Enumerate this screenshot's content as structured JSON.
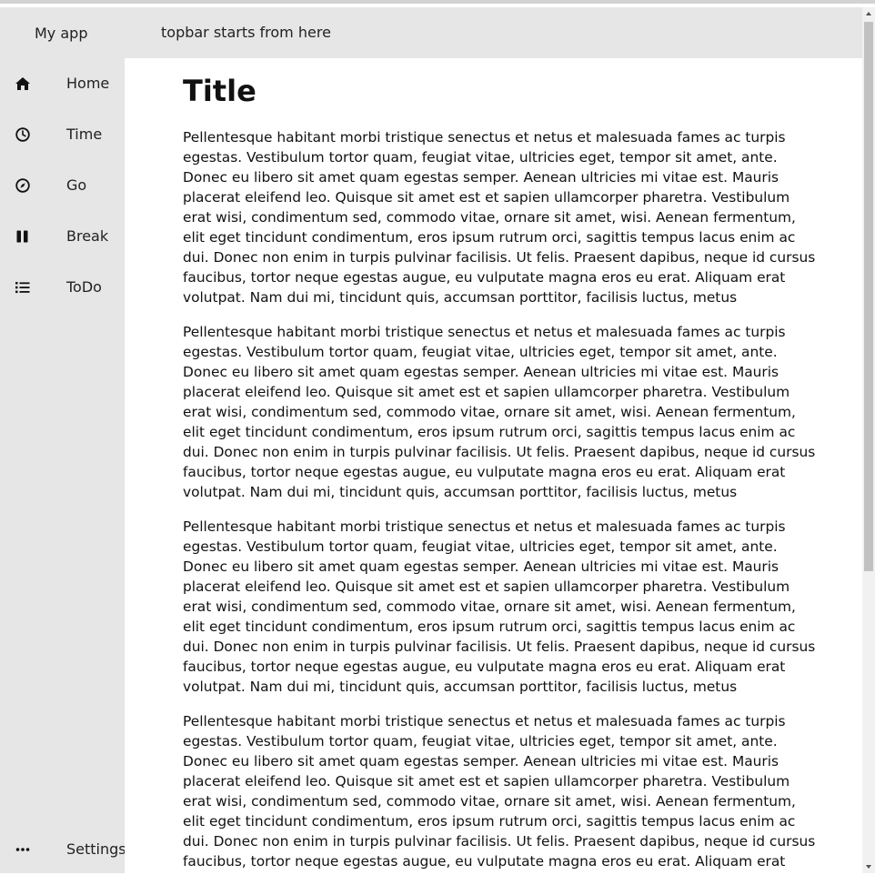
{
  "app": {
    "brand": "My app",
    "topbar_text": "topbar starts from here"
  },
  "sidebar": {
    "items": [
      {
        "label": "Home",
        "icon": "home-icon"
      },
      {
        "label": "Time",
        "icon": "clock-icon"
      },
      {
        "label": "Go",
        "icon": "compass-icon"
      },
      {
        "label": "Break",
        "icon": "pause-icon"
      },
      {
        "label": "ToDo",
        "icon": "list-icon"
      }
    ],
    "settings": {
      "label": "Settings",
      "icon": "ellipsis-icon"
    }
  },
  "main": {
    "title": "Title",
    "paragraphs": [
      "Pellentesque habitant morbi tristique senectus et netus et malesuada fames ac turpis egestas. Vestibulum tortor quam, feugiat vitae, ultricies eget, tempor sit amet, ante. Donec eu libero sit amet quam egestas semper. Aenean ultricies mi vitae est. Mauris placerat eleifend leo. Quisque sit amet est et sapien ullamcorper pharetra. Vestibulum erat wisi, condimentum sed, commodo vitae, ornare sit amet, wisi. Aenean fermentum, elit eget tincidunt condimentum, eros ipsum rutrum orci, sagittis tempus lacus enim ac dui. Donec non enim in turpis pulvinar facilisis. Ut felis. Praesent dapibus, neque id cursus faucibus, tortor neque egestas augue, eu vulputate magna eros eu erat. Aliquam erat volutpat. Nam dui mi, tincidunt quis, accumsan porttitor, facilisis luctus, metus",
      "Pellentesque habitant morbi tristique senectus et netus et malesuada fames ac turpis egestas. Vestibulum tortor quam, feugiat vitae, ultricies eget, tempor sit amet, ante. Donec eu libero sit amet quam egestas semper. Aenean ultricies mi vitae est. Mauris placerat eleifend leo. Quisque sit amet est et sapien ullamcorper pharetra. Vestibulum erat wisi, condimentum sed, commodo vitae, ornare sit amet, wisi. Aenean fermentum, elit eget tincidunt condimentum, eros ipsum rutrum orci, sagittis tempus lacus enim ac dui. Donec non enim in turpis pulvinar facilisis. Ut felis. Praesent dapibus, neque id cursus faucibus, tortor neque egestas augue, eu vulputate magna eros eu erat. Aliquam erat volutpat. Nam dui mi, tincidunt quis, accumsan porttitor, facilisis luctus, metus",
      "Pellentesque habitant morbi tristique senectus et netus et malesuada fames ac turpis egestas. Vestibulum tortor quam, feugiat vitae, ultricies eget, tempor sit amet, ante. Donec eu libero sit amet quam egestas semper. Aenean ultricies mi vitae est. Mauris placerat eleifend leo. Quisque sit amet est et sapien ullamcorper pharetra. Vestibulum erat wisi, condimentum sed, commodo vitae, ornare sit amet, wisi. Aenean fermentum, elit eget tincidunt condimentum, eros ipsum rutrum orci, sagittis tempus lacus enim ac dui. Donec non enim in turpis pulvinar facilisis. Ut felis. Praesent dapibus, neque id cursus faucibus, tortor neque egestas augue, eu vulputate magna eros eu erat. Aliquam erat volutpat. Nam dui mi, tincidunt quis, accumsan porttitor, facilisis luctus, metus",
      "Pellentesque habitant morbi tristique senectus et netus et malesuada fames ac turpis egestas. Vestibulum tortor quam, feugiat vitae, ultricies eget, tempor sit amet, ante. Donec eu libero sit amet quam egestas semper. Aenean ultricies mi vitae est. Mauris placerat eleifend leo. Quisque sit amet est et sapien ullamcorper pharetra. Vestibulum erat wisi, condimentum sed, commodo vitae, ornare sit amet, wisi. Aenean fermentum, elit eget tincidunt condimentum, eros ipsum rutrum orci, sagittis tempus lacus enim ac dui. Donec non enim in turpis pulvinar facilisis. Ut felis. Praesent dapibus, neque id cursus faucibus, tortor neque egestas augue, eu vulputate magna eros eu erat. Aliquam erat volutpat. Nam dui mi, tincidunt quis, accumsan porttitor, facilisis luctus, metus"
    ]
  },
  "colors": {
    "chrome_background": "#e6e6e6",
    "content_background": "#ffffff",
    "text": "#222222",
    "scrollbar_track": "#f1f1f1",
    "scrollbar_thumb": "#c1c1c1"
  }
}
